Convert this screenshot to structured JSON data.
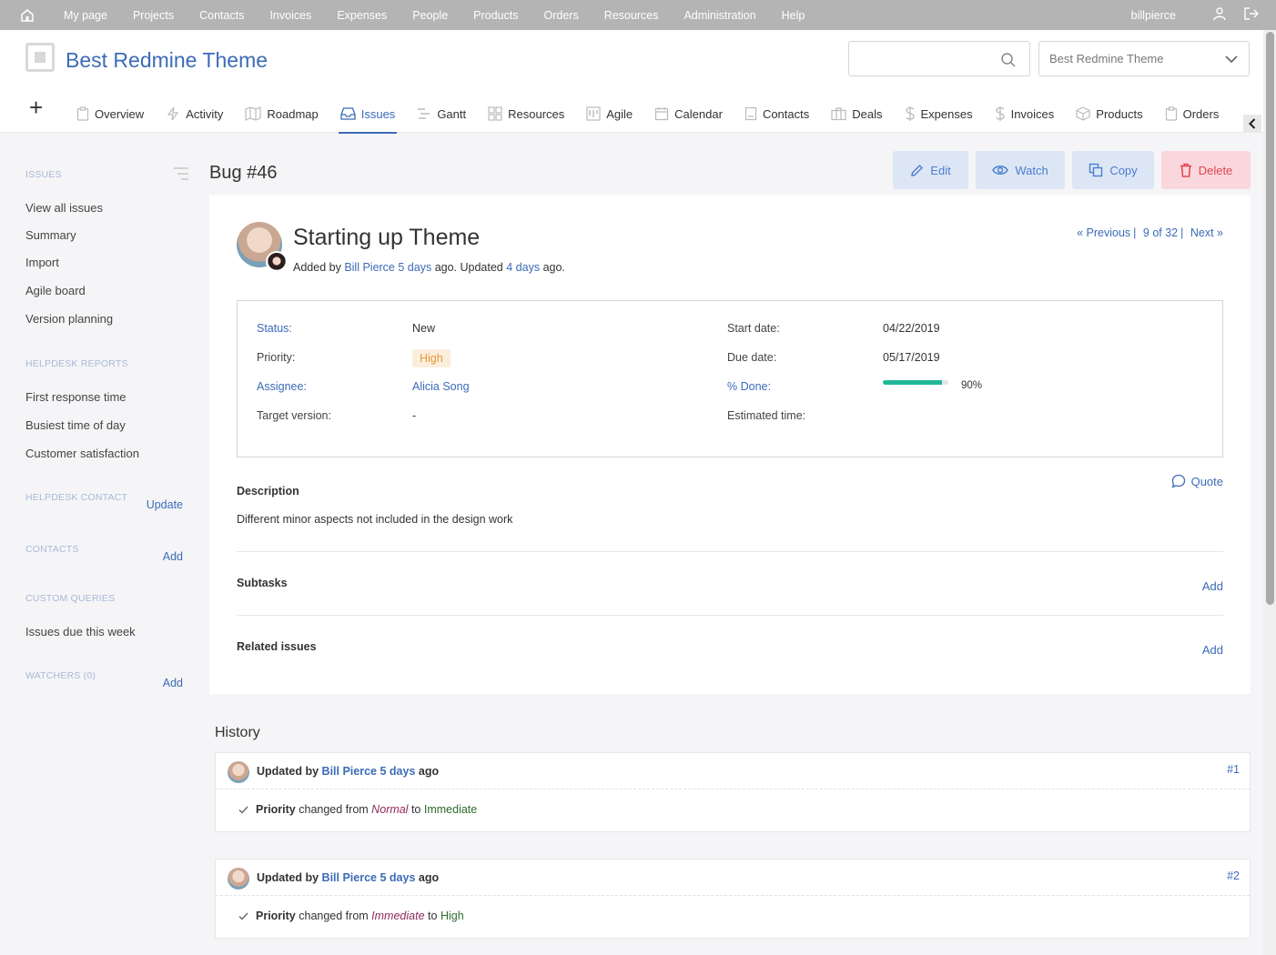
{
  "top_menu": {
    "items": [
      "My page",
      "Projects",
      "Contacts",
      "Invoices",
      "Expenses",
      "People",
      "Products",
      "Orders",
      "Resources",
      "Administration",
      "Help"
    ],
    "user": "billpierce"
  },
  "header": {
    "project_title": "Best Redmine Theme",
    "jump_select": "Best Redmine Theme",
    "search_placeholder": ""
  },
  "tabs": [
    {
      "label": "Overview",
      "icon": "clipboard-icon"
    },
    {
      "label": "Activity",
      "icon": "bolt-icon"
    },
    {
      "label": "Roadmap",
      "icon": "map-icon"
    },
    {
      "label": "Issues",
      "icon": "inbox-icon",
      "active": true
    },
    {
      "label": "Gantt",
      "icon": "gantt-icon"
    },
    {
      "label": "Resources",
      "icon": "grid-icon"
    },
    {
      "label": "Agile",
      "icon": "board-icon"
    },
    {
      "label": "Calendar",
      "icon": "calendar-icon"
    },
    {
      "label": "Contacts",
      "icon": "contact-card-icon"
    },
    {
      "label": "Deals",
      "icon": "briefcase-icon"
    },
    {
      "label": "Expenses",
      "icon": "dollar-icon"
    },
    {
      "label": "Invoices",
      "icon": "dollar-icon"
    },
    {
      "label": "Products",
      "icon": "box-icon"
    },
    {
      "label": "Orders",
      "icon": "clipboard-icon"
    }
  ],
  "sidebar": {
    "issues_heading": "Issues",
    "issues_links": [
      "View all issues",
      "Summary",
      "Import",
      "Agile board",
      "Version planning"
    ],
    "helpdesk_reports_heading": "Helpdesk reports",
    "helpdesk_reports": [
      "First response time",
      "Busiest time of day",
      "Customer satisfaction"
    ],
    "helpdesk_contact_heading": "Helpdesk contact",
    "helpdesk_contact_action": "Update",
    "contacts_heading": "Contacts",
    "contacts_action": "Add",
    "custom_queries_heading": "Custom queries",
    "custom_queries": [
      "Issues due this week"
    ],
    "watchers_heading": "Watchers (0)",
    "watchers_action": "Add"
  },
  "issue": {
    "heading": "Bug #46",
    "subject": "Starting up Theme",
    "added_by_prefix": "Added by",
    "author": "Bill Pierce",
    "created_ago": "5 days",
    "updated_prefix": "ago. Updated",
    "updated_ago": "4 days",
    "updated_suffix": "ago.",
    "nav": {
      "previous": "« Previous",
      "position": "9 of 32",
      "next": "Next »"
    },
    "actions": {
      "edit": "Edit",
      "watch": "Watch",
      "copy": "Copy",
      "delete": "Delete"
    },
    "attributes": {
      "status_label": "Status:",
      "status": "New",
      "priority_label": "Priority:",
      "priority": "High",
      "assignee_label": "Assignee:",
      "assignee": "Alicia Song",
      "target_version_label": "Target version:",
      "target_version": "-",
      "start_date_label": "Start date:",
      "start_date": "04/22/2019",
      "due_date_label": "Due date:",
      "due_date": "05/17/2019",
      "done_label": "% Done:",
      "done_text": "90%",
      "done_value": 0.9,
      "estimated_label": "Estimated time:",
      "estimated": ""
    },
    "description_heading": "Description",
    "description": "Different minor aspects not included in the design work",
    "quote": "Quote",
    "subtasks_heading": "Subtasks",
    "subtasks_action": "Add",
    "related_heading": "Related issues",
    "related_action": "Add"
  },
  "history": {
    "heading": "History",
    "journals": [
      {
        "prefix": "Updated by",
        "user": "Bill Pierce",
        "ago": "5 days",
        "suffix": "ago",
        "num": "#1",
        "field": "Priority",
        "changed_from": "changed from",
        "old": "Normal",
        "to": "to",
        "new": "Immediate"
      },
      {
        "prefix": "Updated by",
        "user": "Bill Pierce",
        "ago": "5 days",
        "suffix": "ago",
        "num": "#2",
        "field": "Priority",
        "changed_from": "changed from",
        "old": "Immediate",
        "to": "to",
        "new": "High"
      }
    ]
  },
  "colors": {
    "accent": "#3b6bb8",
    "progress": "#21b89a",
    "delete": "#e0434e",
    "priority_high": "#e59a36"
  }
}
